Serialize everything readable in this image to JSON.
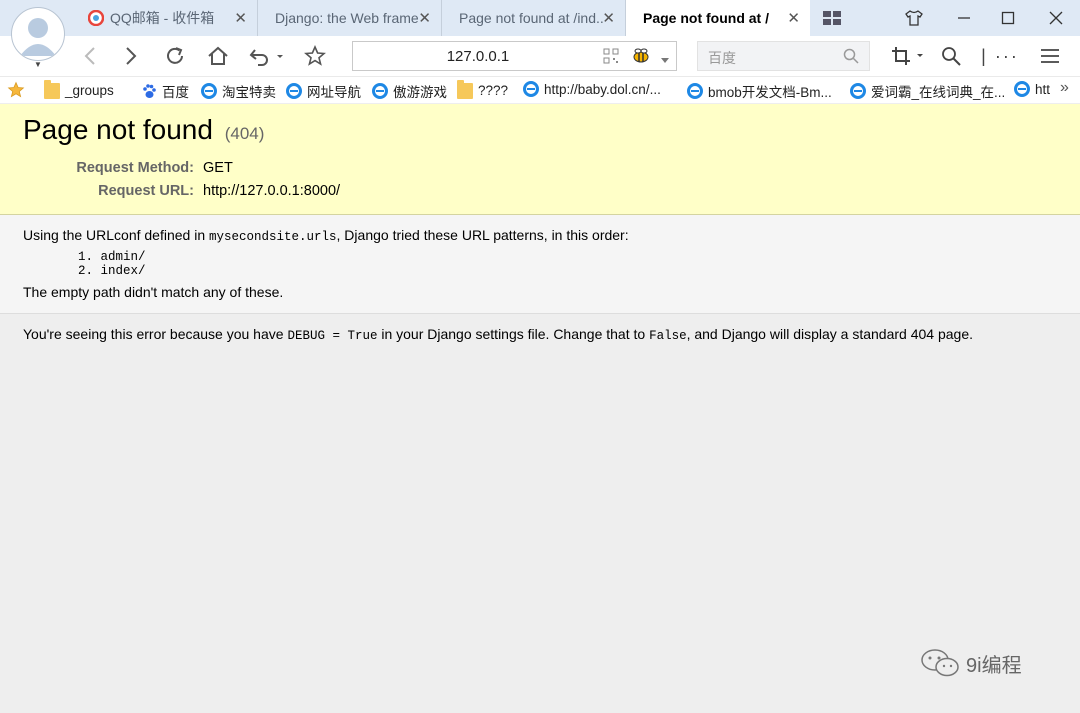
{
  "browser": {
    "tabs": [
      {
        "title": "QQ邮箱 - 收件箱"
      },
      {
        "title": "Django: the Web frame..."
      },
      {
        "title": "Page not found at /ind..."
      },
      {
        "title": "Page not found at /"
      }
    ],
    "address": "127.0.0.1",
    "search_placeholder": "百度",
    "bookmarks": [
      {
        "label": "_groups",
        "icon": "folder-icon"
      },
      {
        "label": "百度",
        "icon": "baidu-paw-icon"
      },
      {
        "label": "淘宝特卖",
        "icon": "ie-icon"
      },
      {
        "label": "网址导航",
        "icon": "ie-icon"
      },
      {
        "label": "傲游游戏",
        "icon": "ie-icon"
      },
      {
        "label": "????",
        "icon": "folder-icon"
      },
      {
        "label": "http://baby.dol.cn/...",
        "icon": "ie-icon"
      },
      {
        "label": "bmob开发文档-Bm...",
        "icon": "ie-icon"
      },
      {
        "label": "爱词霸_在线词典_在...",
        "icon": "ie-icon"
      },
      {
        "label": "htt",
        "icon": "ie-icon"
      }
    ],
    "more_bookmarks": "»"
  },
  "page": {
    "title": "Page not found",
    "status_code": "(404)",
    "request_method_label": "Request Method:",
    "request_method": "GET",
    "request_url_label": "Request URL:",
    "request_url": "http://127.0.0.1:8000/",
    "urlconf_prefix": "Using the URLconf defined in ",
    "urlconf_module": "mysecondsite.urls",
    "urlconf_suffix": ", Django tried these URL patterns, in this order:",
    "patterns": [
      "1. admin/",
      "2. index/"
    ],
    "no_match": "The empty path didn't match any of these.",
    "explanation_1": "You're seeing this error because you have ",
    "debug_code": "DEBUG = True",
    "explanation_2": " in your Django settings file. Change that to ",
    "false_code": "False",
    "explanation_3": ", and Django will display a standard 404 page."
  },
  "watermark": "9i编程",
  "colors": {
    "summary_bg": "#ffffc8",
    "info_bg": "#f5f5f5",
    "page_bg": "#eeeeee",
    "chrome_bg": "#dfe9f5"
  }
}
